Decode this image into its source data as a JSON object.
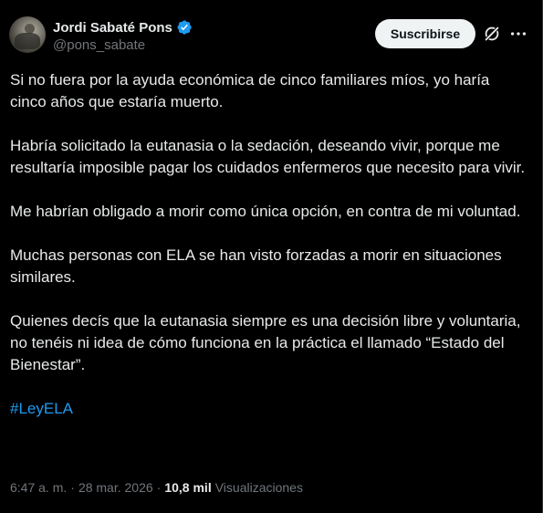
{
  "author": {
    "name": "Jordi Sabaté Pons",
    "handle": "@pons_sabate"
  },
  "actions": {
    "subscribe_label": "Suscribirse"
  },
  "icons": {
    "verified": "verified-badge-icon",
    "grok": "grok-icon",
    "more": "more-options-icon",
    "verified_color": "#1d9bf0"
  },
  "post": {
    "paragraphs": [
      "Si no fuera por la ayuda económica de cinco familiares míos, yo haría cinco años que estaría muerto.",
      "Habría solicitado la eutanasia o la sedación, deseando vivir, porque me resultaría imposible pagar los cuidados enfermeros que necesito para vivir.",
      "Me habrían obligado a morir como única opción, en contra de mi voluntad.",
      "Muchas personas con ELA se han visto forzadas a morir en situaciones similares.",
      "Quienes decís que la eutanasia siempre es una decisión libre y voluntaria, no tenéis ni idea de cómo funciona en la práctica el llamado “Estado del Bienestar”."
    ],
    "hashtag": "#LeyELA"
  },
  "meta": {
    "time": "6:47 a. m.",
    "separator": "·",
    "date": "28 mar. 2026",
    "views_count": "10,8 mil",
    "views_label": "Visualizaciones"
  }
}
